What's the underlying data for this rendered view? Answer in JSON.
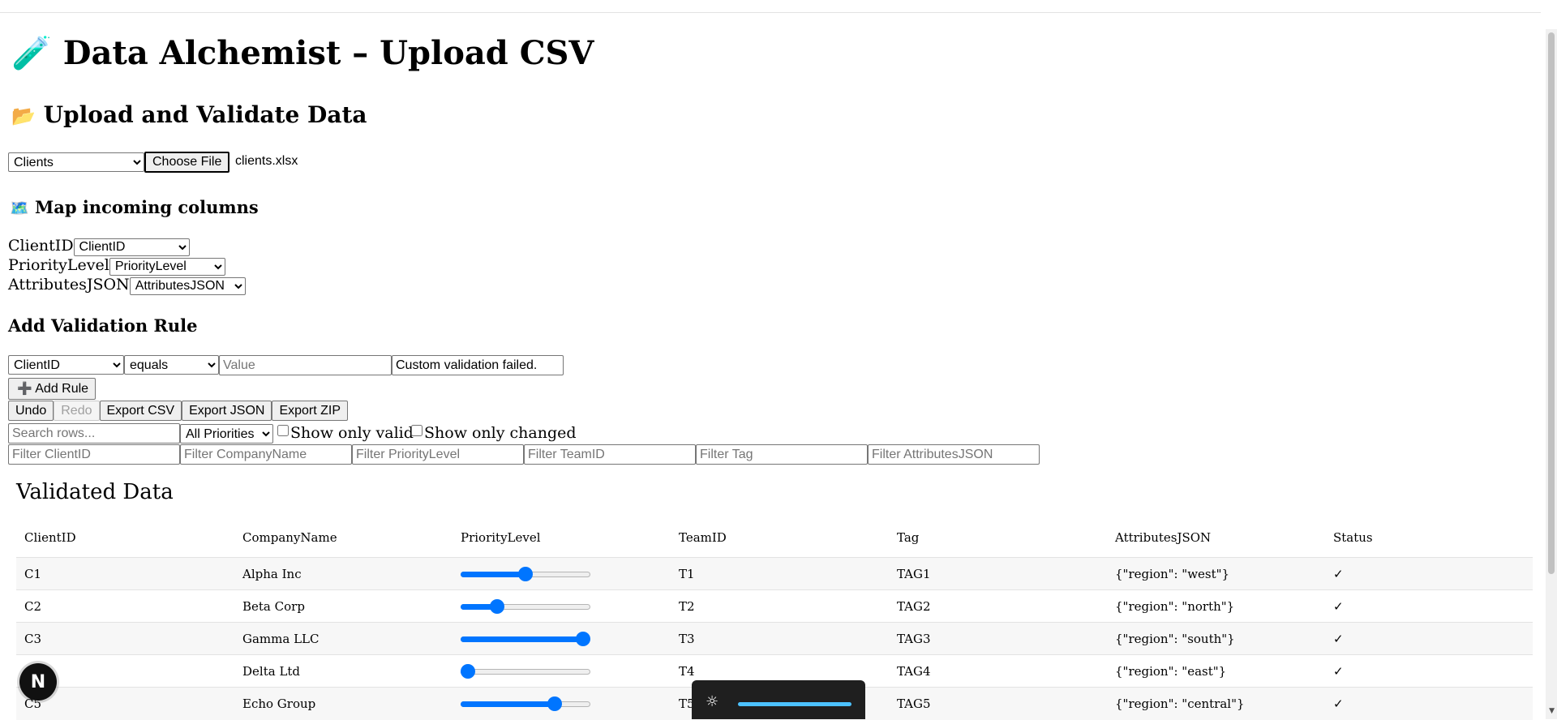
{
  "app": {
    "title_icon": "🧪",
    "title": "Data Alchemist – Upload CSV"
  },
  "upload": {
    "heading_icon": "📂",
    "heading": "Upload and Validate Data",
    "entity_select_value": "Clients",
    "choose_file_label": "Choose File",
    "file_name": "clients.xlsx"
  },
  "mapping": {
    "heading_icon": "🗺️",
    "heading": "Map incoming columns",
    "rows": [
      {
        "label": "ClientID",
        "selected": "ClientID"
      },
      {
        "label": "PriorityLevel",
        "selected": "PriorityLevel"
      },
      {
        "label": "AttributesJSON",
        "selected": "AttributesJSON"
      }
    ]
  },
  "rule": {
    "heading": "Add Validation Rule",
    "field_value": "ClientID",
    "operator_value": "equals",
    "value_placeholder": "Value",
    "message_value": "Custom validation failed.",
    "add_icon": "➕",
    "add_label": "Add Rule"
  },
  "toolbar": {
    "undo": "Undo",
    "redo": "Redo",
    "export_csv": "Export CSV",
    "export_json": "Export JSON",
    "export_zip": "Export ZIP"
  },
  "filters": {
    "search_placeholder": "Search rows...",
    "priority_value": "All Priorities",
    "show_only_valid": "Show only valid",
    "show_only_changed": "Show only changed",
    "column_placeholders": [
      "Filter ClientID",
      "Filter CompanyName",
      "Filter PriorityLevel",
      "Filter TeamID",
      "Filter Tag",
      "Filter AttributesJSON"
    ]
  },
  "table": {
    "title": "Validated Data",
    "columns": [
      "ClientID",
      "CompanyName",
      "PriorityLevel",
      "TeamID",
      "Tag",
      "AttributesJSON",
      "Status"
    ],
    "rows": [
      {
        "client_id": "C1",
        "company": "Alpha Inc",
        "priority": 3,
        "team": "T1",
        "tag": "TAG1",
        "attributes": "{\"region\": \"west\"}",
        "status": "✓"
      },
      {
        "client_id": "C2",
        "company": "Beta Corp",
        "priority": 2,
        "team": "T2",
        "tag": "TAG2",
        "attributes": "{\"region\": \"north\"}",
        "status": "✓"
      },
      {
        "client_id": "C3",
        "company": "Gamma LLC",
        "priority": 5,
        "team": "T3",
        "tag": "TAG3",
        "attributes": "{\"region\": \"south\"}",
        "status": "✓"
      },
      {
        "client_id": "",
        "company": "Delta Ltd",
        "priority": 1,
        "team": "T4",
        "tag": "TAG4",
        "attributes": "{\"region\": \"east\"}",
        "status": "✓"
      },
      {
        "client_id": "C5",
        "company": "Echo Group",
        "priority": 4,
        "team": "T5",
        "tag": "TAG5",
        "attributes": "{\"region\": \"central\"}",
        "status": "✓"
      }
    ],
    "priority_min": 1,
    "priority_max": 5
  },
  "overlay": {
    "fab_letter": "N",
    "brightness_icon": "☼",
    "brightness_level": 1.0
  },
  "colors": {
    "accent": "#0075ff",
    "brightness_bar": "#4cc2ff"
  }
}
